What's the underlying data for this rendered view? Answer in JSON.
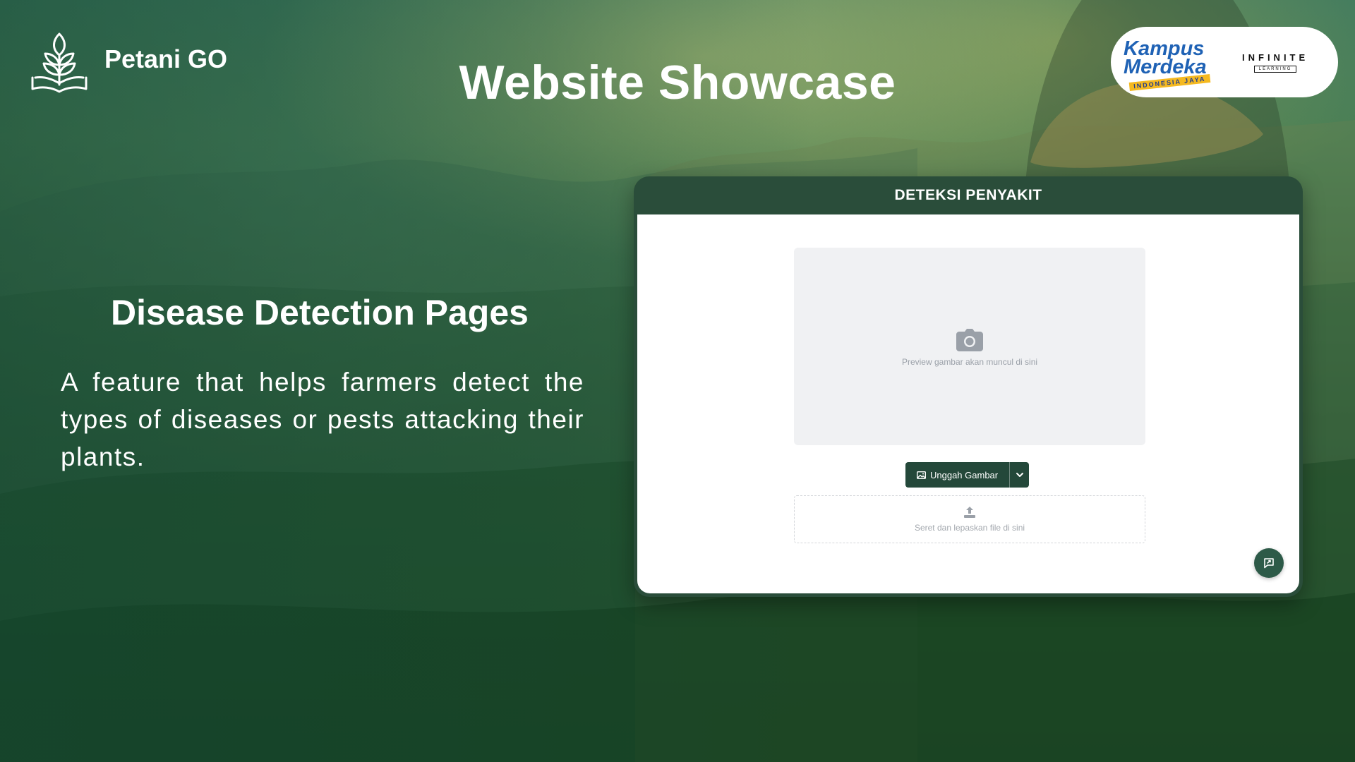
{
  "brand": {
    "name": "Petani GO"
  },
  "header": {
    "title": "Website Showcase"
  },
  "partners": {
    "kampus_merdeka": {
      "line1": "Kampus",
      "line2": "Merdeka",
      "tagline": "INDONESIA JAYA"
    },
    "infinite_learning": {
      "top": "INFINITE",
      "bottom": "LEARNING"
    }
  },
  "feature": {
    "title": "Disease Detection Pages",
    "description": "A feature that helps farmers detect the types of diseases or pests attacking their plants."
  },
  "mockup": {
    "header_title": "DETEKSI PENYAKIT",
    "preview": {
      "icon": "camera-icon",
      "text": "Preview gambar akan muncul di sini"
    },
    "upload_button": {
      "label": "Unggah Gambar",
      "icon": "image-icon"
    },
    "dropdown_icon": "chevron-down-icon",
    "dropzone": {
      "icon": "upload-icon",
      "text": "Seret dan lepaskan file di sini"
    },
    "fab_icon": "chat-icon"
  },
  "colors": {
    "primary_dark_green": "#2a4d3a",
    "button_green": "#24483a",
    "brand_blue": "#1f62b5",
    "brand_yellow": "#f5b920"
  }
}
